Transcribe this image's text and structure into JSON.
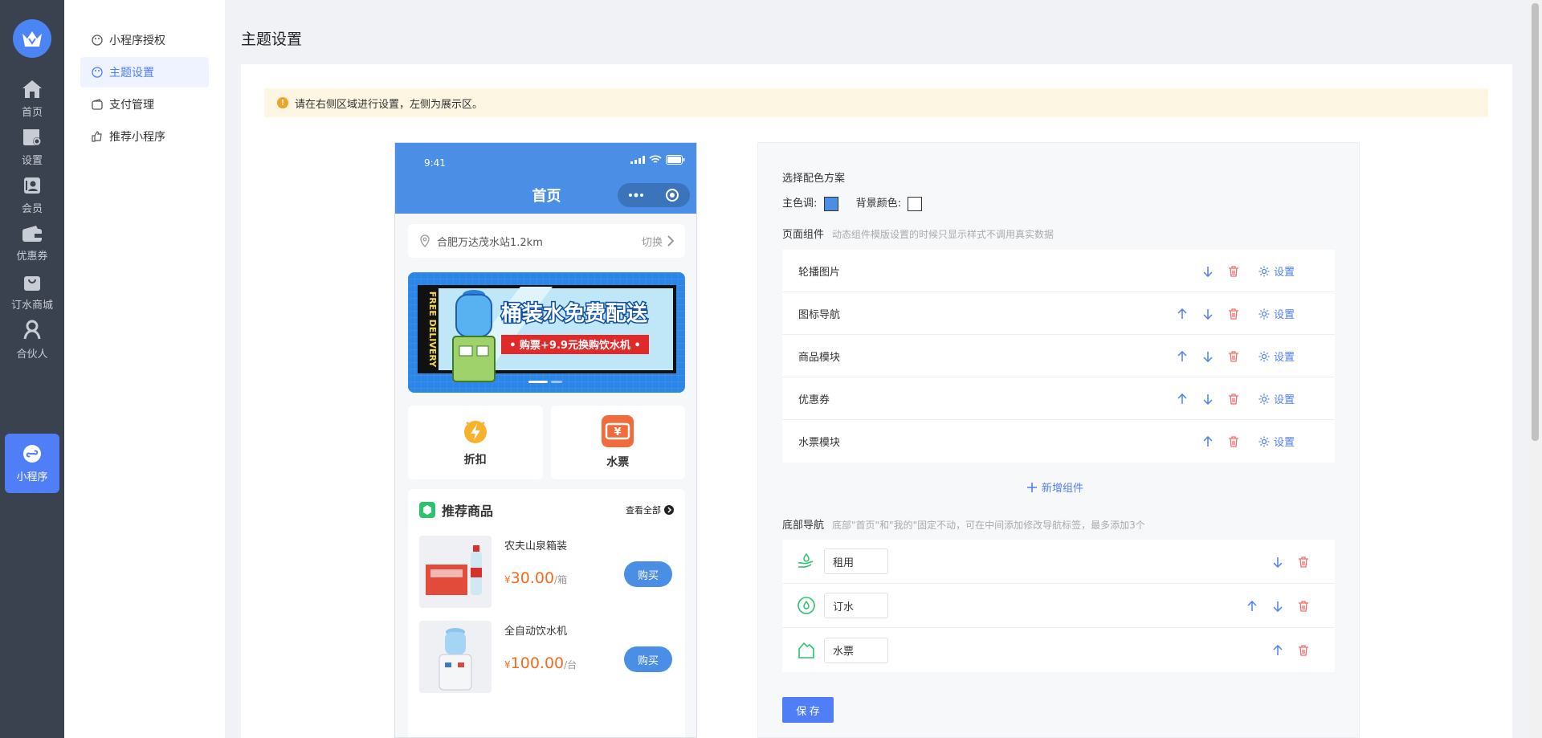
{
  "rail": {
    "items": [
      {
        "label": "首页",
        "icon": "home-icon"
      },
      {
        "label": "设置",
        "icon": "store-settings-icon"
      },
      {
        "label": "会员",
        "icon": "member-icon"
      },
      {
        "label": "优惠券",
        "icon": "wallet-icon"
      },
      {
        "label": "订水商城",
        "icon": "bag-icon"
      },
      {
        "label": "合伙人",
        "icon": "partner-icon"
      },
      {
        "label": "小程序",
        "icon": "miniprogram-icon"
      }
    ],
    "active_color": "#4f7ef7"
  },
  "submenu": {
    "items": [
      {
        "label": "小程序授权"
      },
      {
        "label": "主题设置"
      },
      {
        "label": "支付管理"
      },
      {
        "label": "推荐小程序"
      }
    ]
  },
  "page": {
    "title": "主题设置",
    "alert": "请在右侧区域进行设置，左侧为展示区。"
  },
  "phone": {
    "time": "9:41",
    "title": "首页",
    "location": "合肥万达茂水站1.2km",
    "switch_label": "切换",
    "banner": {
      "side_text": "FREE DELIVERY",
      "headline": "桶装水免费配送",
      "sub": "• 购票+9.9元换购饮水机 •"
    },
    "nav": [
      {
        "label": "折扣"
      },
      {
        "label": "水票"
      }
    ],
    "goods_title": "推荐商品",
    "goods_more": "查看全部",
    "goods": [
      {
        "name": "农夫山泉箱装",
        "symbol": "¥",
        "price": "30.00",
        "unit": "/箱",
        "buy": "购买"
      },
      {
        "name": "全自动饮水机",
        "symbol": "¥",
        "price": "100.00",
        "unit": "/台",
        "buy": "购买"
      }
    ],
    "theme_color": "#4a8ee6"
  },
  "panel": {
    "scheme_label": "选择配色方案",
    "main_color_label": "主色调:",
    "main_color": "#4a8ee6",
    "bg_color_label": "背景颜色:",
    "bg_color": "#ffffff",
    "components_label": "页面组件",
    "components_hint": "动态组件模版设置的时候只显示样式不调用真实数据",
    "components": [
      {
        "label": "轮播图片",
        "setting": "设置"
      },
      {
        "label": "图标导航",
        "setting": "设置"
      },
      {
        "label": "商品模块",
        "setting": "设置"
      },
      {
        "label": "优惠券",
        "setting": "设置"
      },
      {
        "label": "水票模块",
        "setting": "设置"
      }
    ],
    "add_label": "新增组件",
    "bottom_nav_label": "底部导航",
    "bottom_nav_hint": "底部\"首页\"和\"我的\"固定不动，可在中间添加修改导航标签，最多添加3个",
    "bottom_nav": [
      {
        "value": "租用"
      },
      {
        "value": "订水"
      },
      {
        "value": "水票"
      }
    ],
    "save_label": "保 存"
  }
}
